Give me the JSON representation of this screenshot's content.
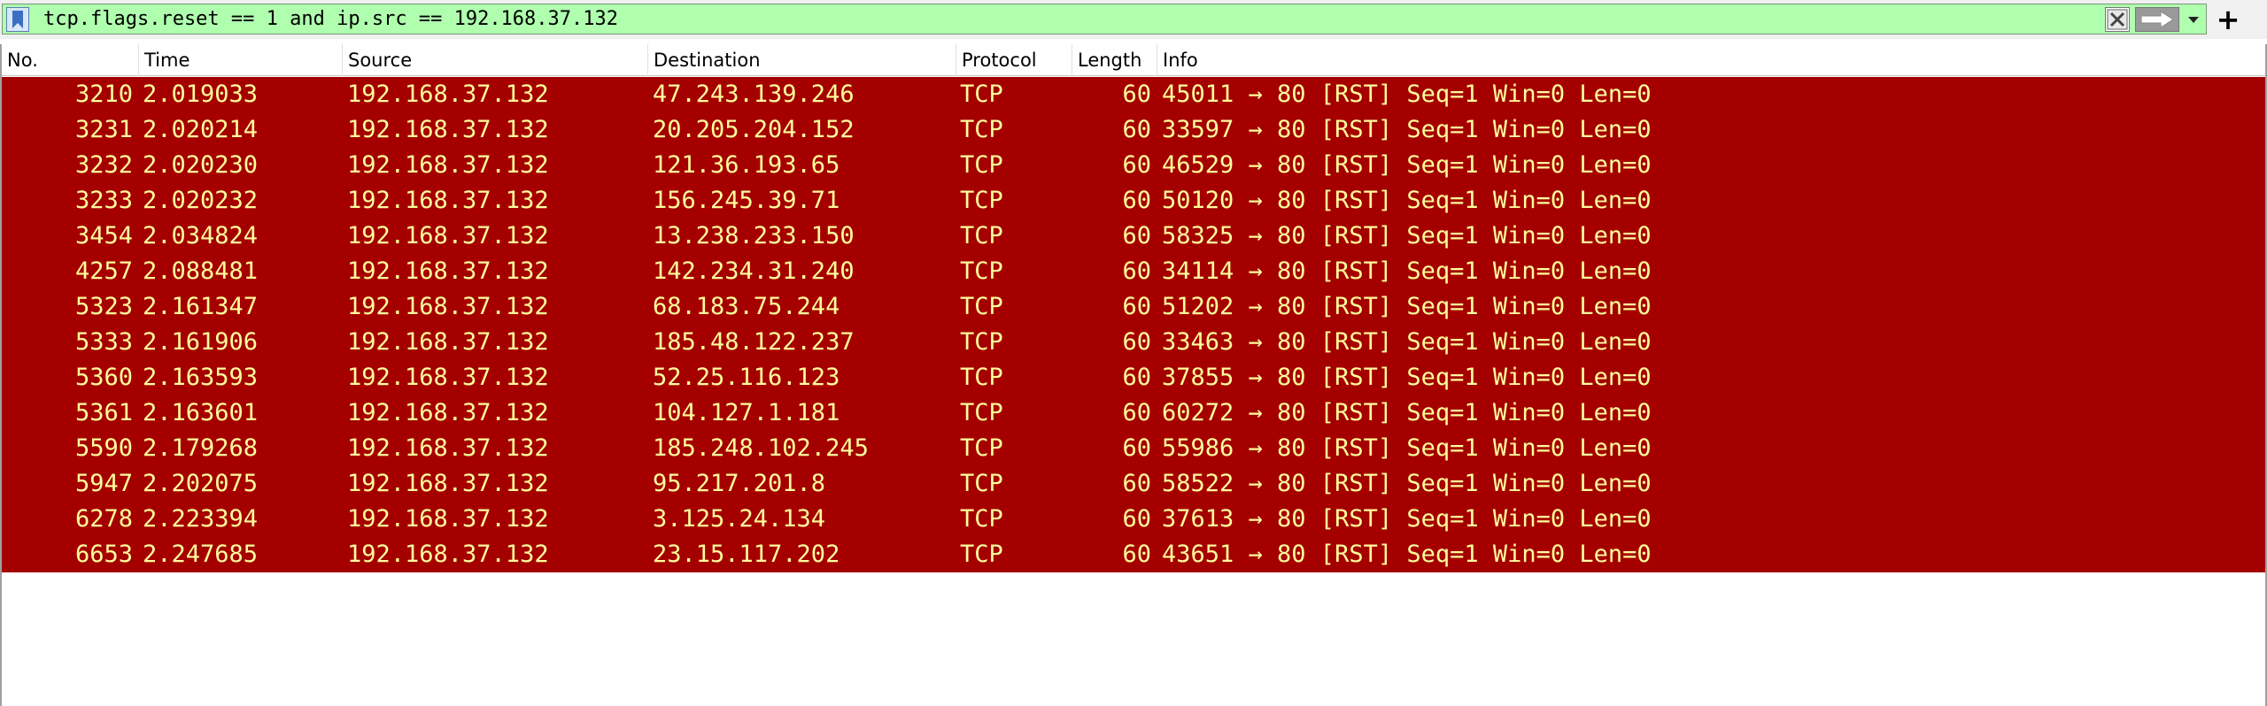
{
  "filter": {
    "expression": "tcp.flags.reset == 1 and ip.src == 192.168.37.132",
    "bg_color": "#afffaf"
  },
  "icons": {
    "bookmark": "bookmark-icon",
    "clear": "clear-x-icon",
    "apply": "arrow-right-icon",
    "dropdown": "chevron-down-icon",
    "add": "plus-icon"
  },
  "table": {
    "columns": [
      "No.",
      "Time",
      "Source",
      "Destination",
      "Protocol",
      "Length",
      "Info"
    ],
    "row_bg": "#a40000",
    "row_fg": "#fffc9c",
    "rows": [
      {
        "no": "3210",
        "time": "2.019033",
        "src": "192.168.37.132",
        "dst": "47.243.139.246",
        "proto": "TCP",
        "len": "60",
        "info": "45011 → 80 [RST] Seq=1 Win=0 Len=0"
      },
      {
        "no": "3231",
        "time": "2.020214",
        "src": "192.168.37.132",
        "dst": "20.205.204.152",
        "proto": "TCP",
        "len": "60",
        "info": "33597 → 80 [RST] Seq=1 Win=0 Len=0"
      },
      {
        "no": "3232",
        "time": "2.020230",
        "src": "192.168.37.132",
        "dst": "121.36.193.65",
        "proto": "TCP",
        "len": "60",
        "info": "46529 → 80 [RST] Seq=1 Win=0 Len=0"
      },
      {
        "no": "3233",
        "time": "2.020232",
        "src": "192.168.37.132",
        "dst": "156.245.39.71",
        "proto": "TCP",
        "len": "60",
        "info": "50120 → 80 [RST] Seq=1 Win=0 Len=0"
      },
      {
        "no": "3454",
        "time": "2.034824",
        "src": "192.168.37.132",
        "dst": "13.238.233.150",
        "proto": "TCP",
        "len": "60",
        "info": "58325 → 80 [RST] Seq=1 Win=0 Len=0"
      },
      {
        "no": "4257",
        "time": "2.088481",
        "src": "192.168.37.132",
        "dst": "142.234.31.240",
        "proto": "TCP",
        "len": "60",
        "info": "34114 → 80 [RST] Seq=1 Win=0 Len=0"
      },
      {
        "no": "5323",
        "time": "2.161347",
        "src": "192.168.37.132",
        "dst": "68.183.75.244",
        "proto": "TCP",
        "len": "60",
        "info": "51202 → 80 [RST] Seq=1 Win=0 Len=0"
      },
      {
        "no": "5333",
        "time": "2.161906",
        "src": "192.168.37.132",
        "dst": "185.48.122.237",
        "proto": "TCP",
        "len": "60",
        "info": "33463 → 80 [RST] Seq=1 Win=0 Len=0"
      },
      {
        "no": "5360",
        "time": "2.163593",
        "src": "192.168.37.132",
        "dst": "52.25.116.123",
        "proto": "TCP",
        "len": "60",
        "info": "37855 → 80 [RST] Seq=1 Win=0 Len=0"
      },
      {
        "no": "5361",
        "time": "2.163601",
        "src": "192.168.37.132",
        "dst": "104.127.1.181",
        "proto": "TCP",
        "len": "60",
        "info": "60272 → 80 [RST] Seq=1 Win=0 Len=0"
      },
      {
        "no": "5590",
        "time": "2.179268",
        "src": "192.168.37.132",
        "dst": "185.248.102.245",
        "proto": "TCP",
        "len": "60",
        "info": "55986 → 80 [RST] Seq=1 Win=0 Len=0"
      },
      {
        "no": "5947",
        "time": "2.202075",
        "src": "192.168.37.132",
        "dst": "95.217.201.8",
        "proto": "TCP",
        "len": "60",
        "info": "58522 → 80 [RST] Seq=1 Win=0 Len=0"
      },
      {
        "no": "6278",
        "time": "2.223394",
        "src": "192.168.37.132",
        "dst": "3.125.24.134",
        "proto": "TCP",
        "len": "60",
        "info": "37613 → 80 [RST] Seq=1 Win=0 Len=0"
      },
      {
        "no": "6653",
        "time": "2.247685",
        "src": "192.168.37.132",
        "dst": "23.15.117.202",
        "proto": "TCP",
        "len": "60",
        "info": "43651 → 80 [RST] Seq=1 Win=0 Len=0"
      }
    ]
  }
}
